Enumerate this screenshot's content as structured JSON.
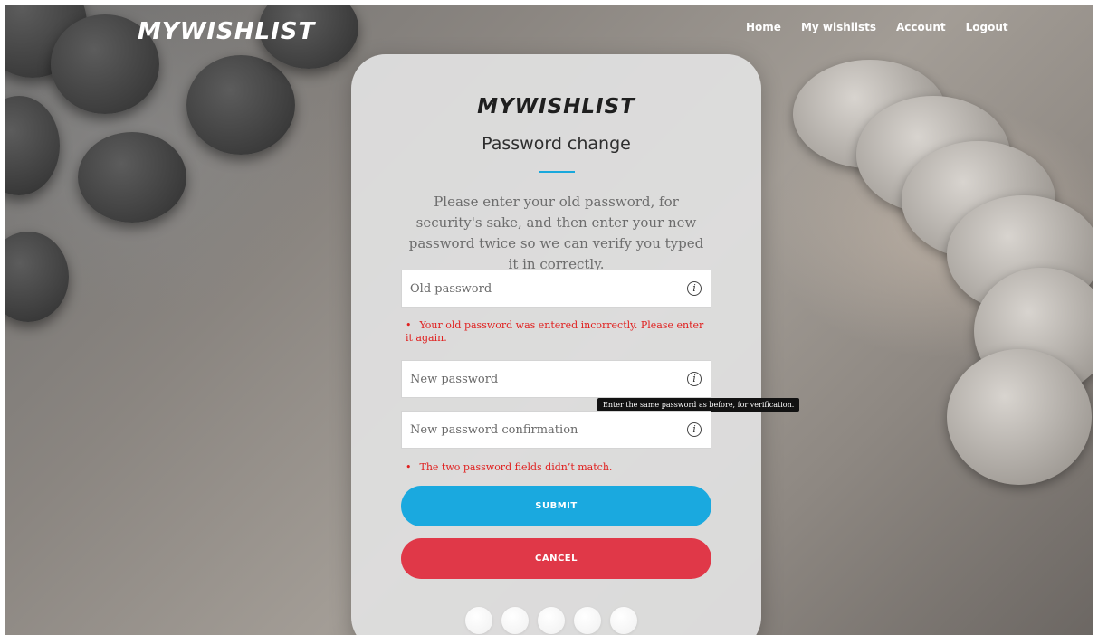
{
  "header": {
    "logo": "MYWISHLIST",
    "nav": [
      {
        "label": "Home"
      },
      {
        "label": "My wishlists"
      },
      {
        "label": "Account"
      },
      {
        "label": "Logout"
      }
    ]
  },
  "card": {
    "logo": "MYWISHLIST",
    "title": "Password change",
    "description": "Please enter your old password, for security's sake, and then enter your new password twice so we can verify you typed it in correctly."
  },
  "form": {
    "old_password": {
      "placeholder": "Old password",
      "value": "",
      "error": "Your old password was entered incorrectly. Please enter it again."
    },
    "new_password": {
      "placeholder": "New password",
      "value": ""
    },
    "confirm_password": {
      "placeholder": "New password confirmation",
      "value": "",
      "tooltip": "Enter the same password as before, for verification.",
      "error": "The two password fields didn’t match."
    },
    "error_bullet": "•",
    "info_glyph": "i",
    "submit_label": "SUBMIT",
    "cancel_label": "CANCEL"
  },
  "icons": {
    "field_info": "info-circle-icon"
  },
  "colors": {
    "accent": "#1aa9df",
    "danger": "#e03848",
    "error_text": "#e0201f"
  }
}
